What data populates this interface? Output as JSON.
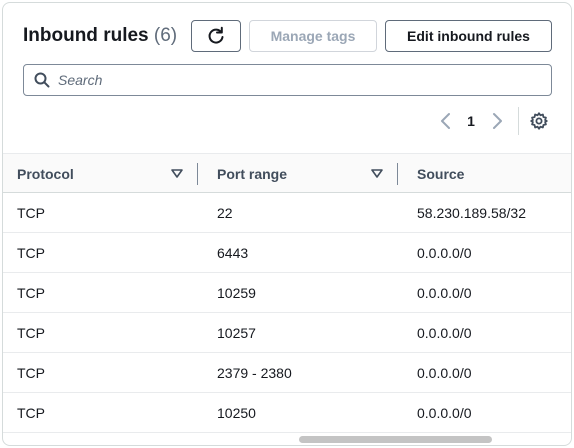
{
  "header": {
    "title": "Inbound rules",
    "count": "(6)",
    "manage_tags_label": "Manage tags",
    "edit_rules_label": "Edit inbound rules"
  },
  "search": {
    "placeholder": "Search",
    "value": ""
  },
  "pagination": {
    "current_page": "1"
  },
  "table": {
    "columns": [
      "Protocol",
      "Port range",
      "Source"
    ],
    "rows": [
      {
        "protocol": "TCP",
        "port_range": "22",
        "source": "58.230.189.58/32"
      },
      {
        "protocol": "TCP",
        "port_range": "6443",
        "source": "0.0.0.0/0"
      },
      {
        "protocol": "TCP",
        "port_range": "10259",
        "source": "0.0.0.0/0"
      },
      {
        "protocol": "TCP",
        "port_range": "10257",
        "source": "0.0.0.0/0"
      },
      {
        "protocol": "TCP",
        "port_range": "2379 - 2380",
        "source": "0.0.0.0/0"
      },
      {
        "protocol": "TCP",
        "port_range": "10250",
        "source": "0.0.0.0/0"
      }
    ]
  },
  "icons": {
    "refresh": "refresh-icon",
    "search": "search-icon",
    "prev": "chevron-left-icon",
    "next": "chevron-right-icon",
    "settings": "gear-icon",
    "sort": "sort-triangle-icon"
  },
  "colors": {
    "text": "#16191f",
    "muted": "#5f6b7a",
    "disabled": "#9ba7b6",
    "border": "#d5dbdb"
  }
}
